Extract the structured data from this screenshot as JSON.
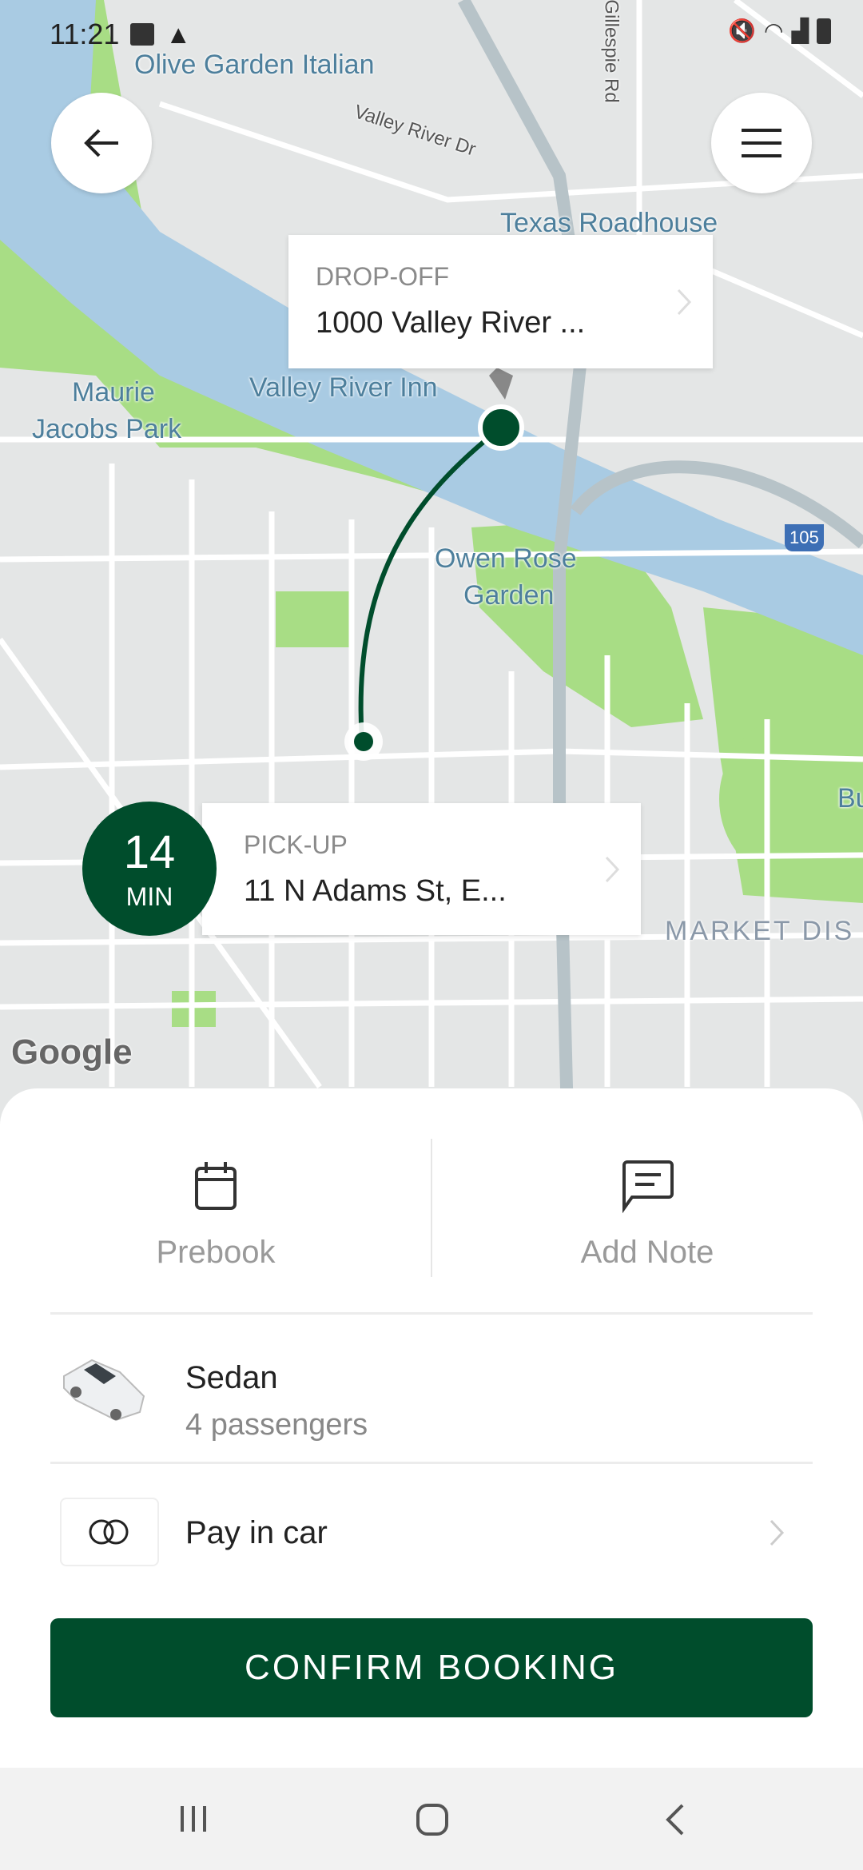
{
  "status_bar": {
    "time": "11:21"
  },
  "map": {
    "labels": {
      "olive_garden": "Olive Garden Italian",
      "texas_roadhouse": "Texas Roadhouse",
      "valley_river_dr": "Valley River Dr",
      "gillespie_rd": "Gillespie Rd",
      "maurie_1": "Maurie",
      "maurie_2": "Jacobs Park",
      "valley_river_inn": "Valley River Inn",
      "owen_1": "Owen Rose",
      "owen_2": "Garden",
      "market": "MARKET DIS",
      "highway": "105",
      "bu": "Bu",
      "google": "Google"
    },
    "dropoff": {
      "label": "DROP-OFF",
      "address": "1000 Valley River ..."
    },
    "pickup": {
      "label": "PICK-UP",
      "address": "11 N Adams St, E..."
    },
    "eta": {
      "value": "14",
      "unit": "MIN"
    }
  },
  "actions": {
    "prebook": "Prebook",
    "add_note": "Add Note"
  },
  "vehicle": {
    "name": "Sedan",
    "capacity": "4 passengers"
  },
  "payment": {
    "method": "Pay in car"
  },
  "confirm_label": "CONFIRM BOOKING",
  "colors": {
    "brand": "#004d2c",
    "water": "#a9cbe3",
    "park": "#a8dd85"
  }
}
